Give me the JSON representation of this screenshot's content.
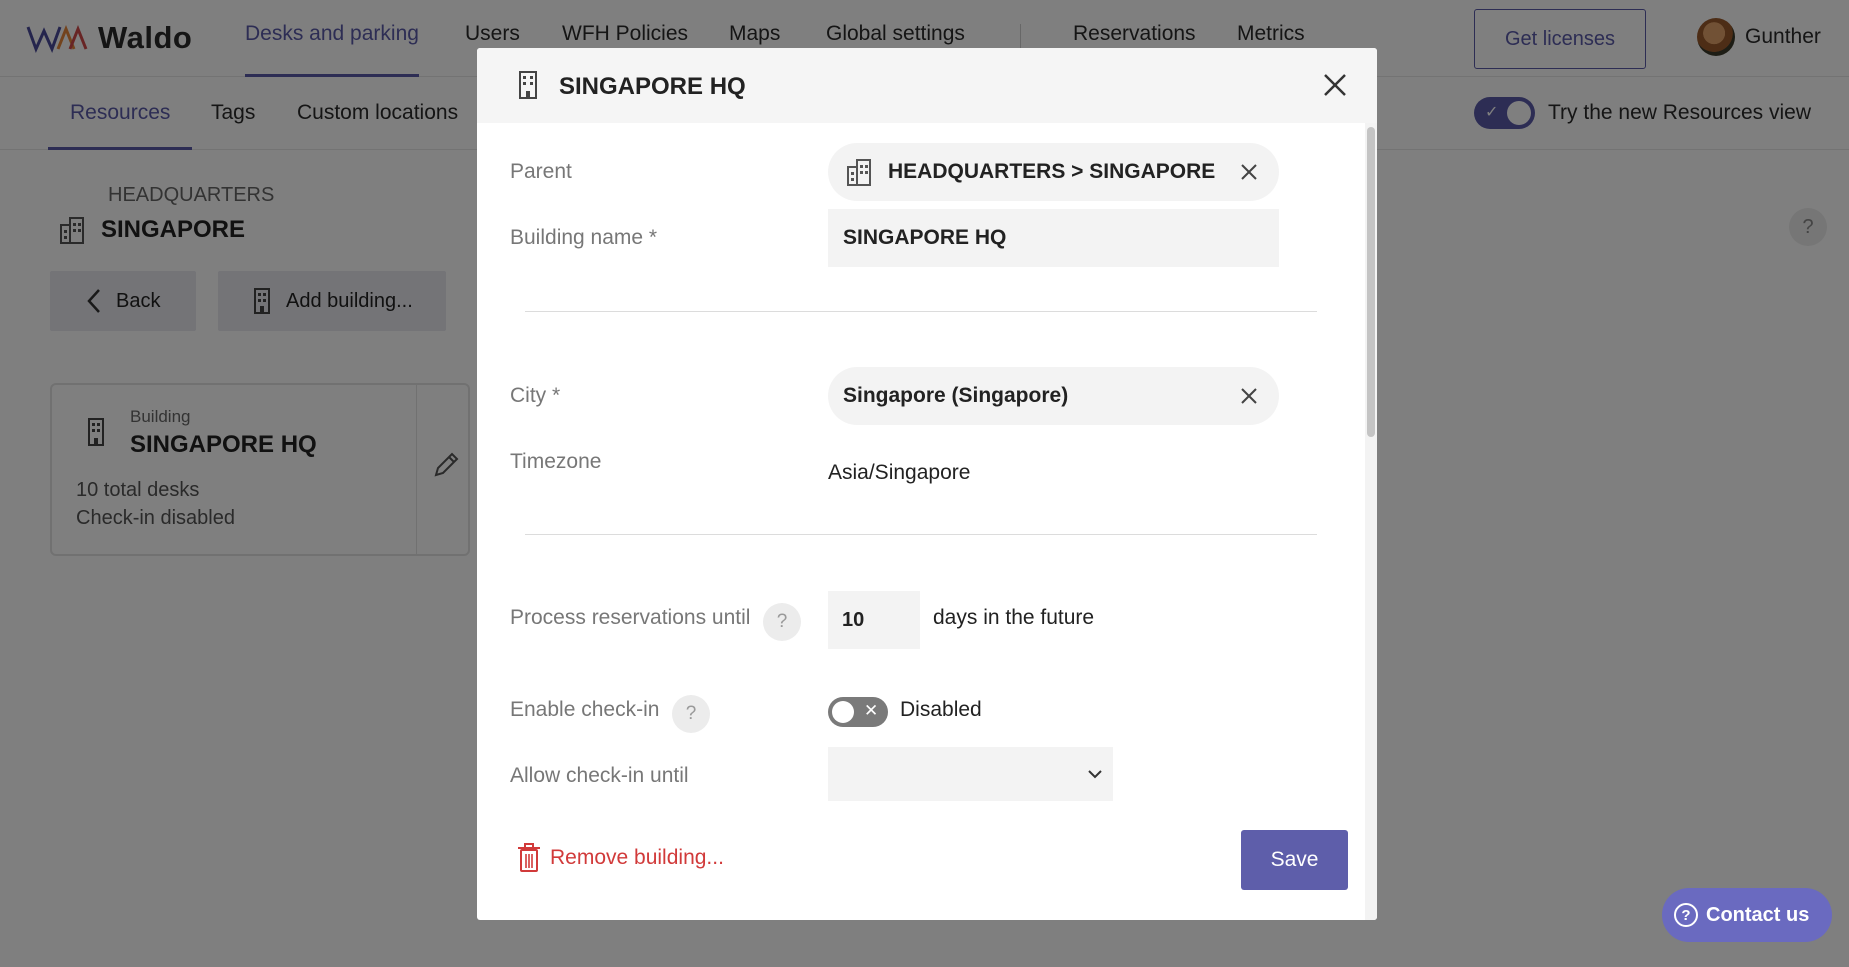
{
  "brand": {
    "name": "Waldo"
  },
  "topnav": {
    "items": [
      "Desks and parking",
      "Users",
      "WFH Policies",
      "Maps",
      "Global settings",
      "Reservations",
      "Metrics"
    ],
    "licenses_label": "Get licenses",
    "user_name": "Gunther"
  },
  "subnav": {
    "items": [
      "Resources",
      "Tags",
      "Custom locations"
    ],
    "try_label": "Try the new Resources view"
  },
  "breadcrumb": {
    "parent": "HEADQUARTERS",
    "title": "SINGAPORE"
  },
  "actions": {
    "back": "Back",
    "add_building": "Add building..."
  },
  "card": {
    "type": "Building",
    "name": "SINGAPORE HQ",
    "desks": "10 total desks",
    "checkin": "Check-in disabled"
  },
  "modal": {
    "title": "SINGAPORE HQ",
    "parent_label": "Parent",
    "parent_value": "HEADQUARTERS > SINGAPORE",
    "building_name_label": "Building name *",
    "building_name_value": "SINGAPORE HQ",
    "city_label": "City *",
    "city_value": "Singapore (Singapore)",
    "timezone_label": "Timezone",
    "timezone_value": "Asia/Singapore",
    "process_label": "Process reservations until",
    "process_value": "10",
    "process_suffix": "days in the future",
    "checkin_label": "Enable check-in",
    "checkin_state": "Disabled",
    "allow_label": "Allow check-in until",
    "allow_value": "",
    "remove_label": "Remove building...",
    "save_label": "Save"
  },
  "help": {
    "q": "?"
  },
  "contact": {
    "label": "Contact us"
  },
  "colors": {
    "accent": "#5a5aa8",
    "danger": "#d13a3a",
    "save": "#5e5eaa"
  }
}
